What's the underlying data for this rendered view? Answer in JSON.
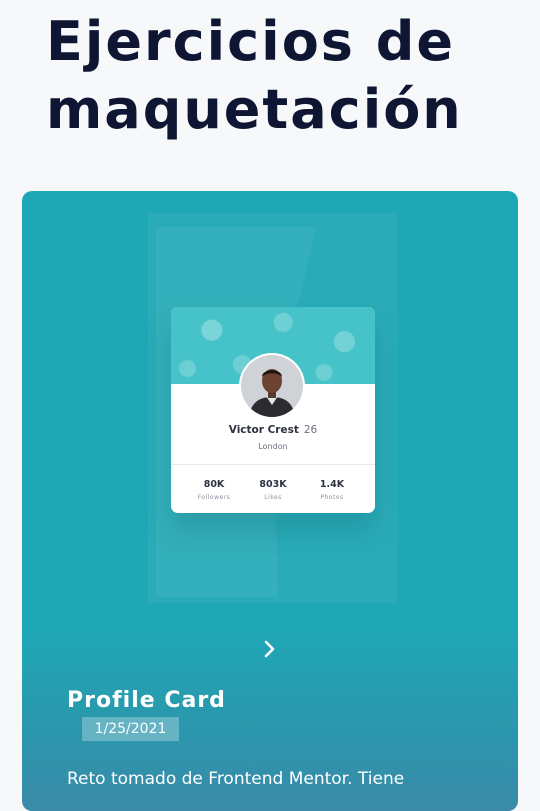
{
  "page": {
    "title": "Ejercicios de maquetación"
  },
  "colors": {
    "panel": "#1ea8b5",
    "title": "#0e1633",
    "card_cover": "#46c3c9"
  },
  "profile_card": {
    "name": "Victor Crest",
    "age": "26",
    "city": "London",
    "stats": [
      {
        "value": "80K",
        "label": "Followers"
      },
      {
        "value": "803K",
        "label": "Likes"
      },
      {
        "value": "1.4K",
        "label": "Photos"
      }
    ]
  },
  "project": {
    "title": "Profile Card",
    "date": "1/25/2021",
    "description": "Reto tomado de Frontend Mentor. Tiene"
  },
  "icons": {
    "next": "chevron-right-icon"
  }
}
